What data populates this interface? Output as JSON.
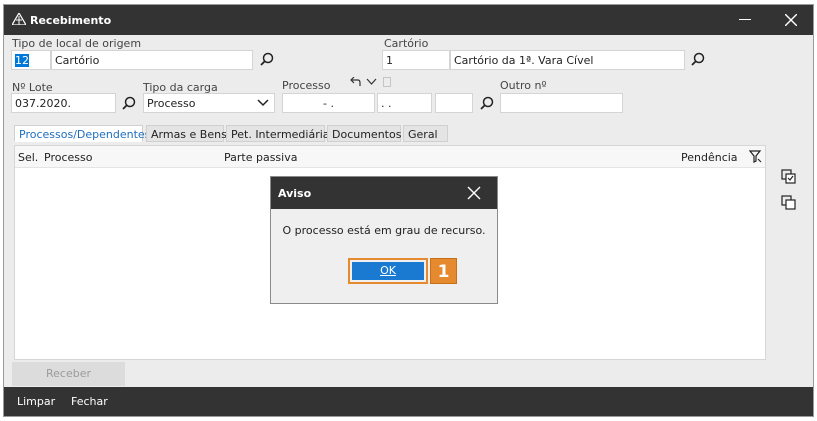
{
  "window": {
    "title": "Recebimento"
  },
  "origem": {
    "label": "Tipo de local de origem",
    "code": "12",
    "name": "Cartório"
  },
  "cartorio": {
    "label": "Cartório",
    "code": "1",
    "name": "Cartório da 1ª. Vara Cível"
  },
  "lote": {
    "label": "Nº Lote",
    "value": "037.2020."
  },
  "carga": {
    "label": "Tipo da carga",
    "value": "Processo"
  },
  "processo": {
    "label": "Processo",
    "value1": "- .",
    "value2": ". ."
  },
  "outro": {
    "label": "Outro nº",
    "value": ""
  },
  "tabs": [
    {
      "label": "Processos/Dependentes"
    },
    {
      "label": "Armas e Bens"
    },
    {
      "label": "Pet. Intermediária"
    },
    {
      "label": "Documentos"
    },
    {
      "label": "Geral"
    }
  ],
  "grid": {
    "columns": [
      "Sel.",
      "Processo",
      "Parte passiva",
      "Pendência"
    ]
  },
  "buttons": {
    "receber": "Receber"
  },
  "footer": {
    "limpar": "Limpar",
    "fechar": "Fechar"
  },
  "dialog": {
    "title": "Aviso",
    "message": "O processo está em grau de recurso.",
    "ok": "OK",
    "callout": "1"
  },
  "colors": {
    "titlebar": "#333333",
    "accent": "#1a7ad2",
    "callout": "#e58a2e"
  }
}
